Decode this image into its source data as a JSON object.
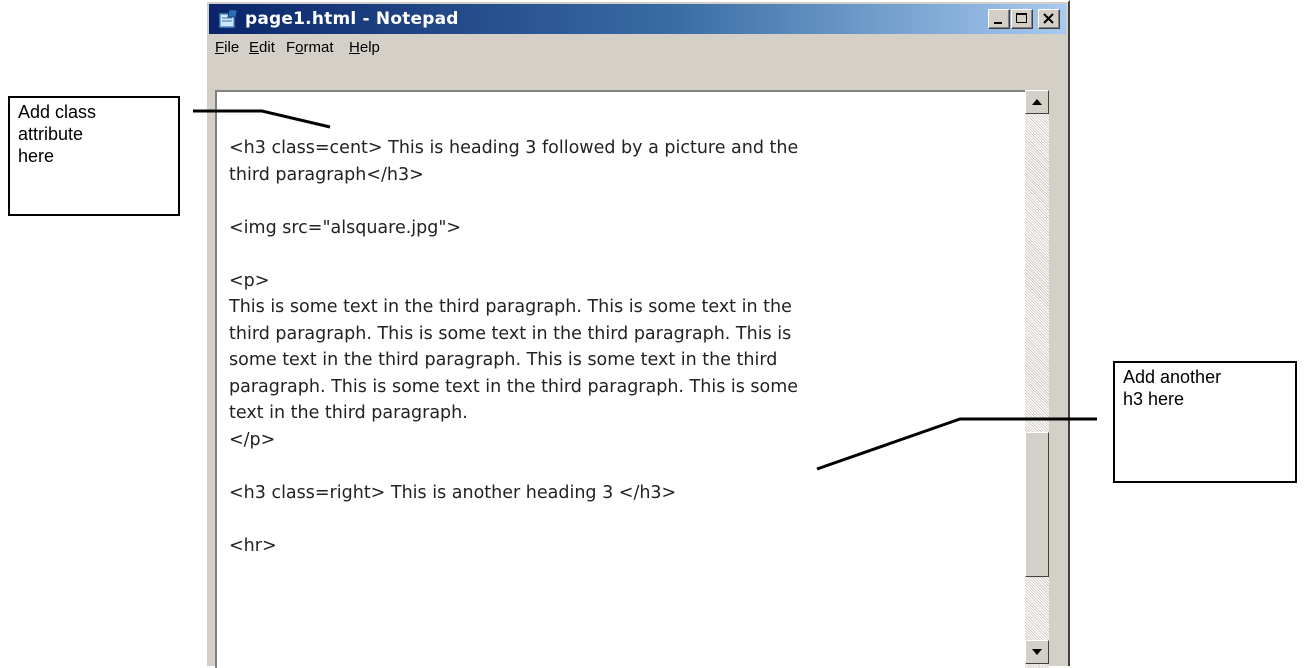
{
  "window": {
    "title": "page1.html - Notepad",
    "icon": "notepad-icon"
  },
  "menu": [
    {
      "label": "File",
      "mnemonic_index": 0
    },
    {
      "label": "Edit",
      "mnemonic_index": 0
    },
    {
      "label": "Format",
      "mnemonic_index": 1
    },
    {
      "label": "Help",
      "mnemonic_index": 0
    }
  ],
  "editor": {
    "text": "<h3 class=cent> This is heading 3 followed by a picture and the\nthird paragraph</h3>\n\n<img src=\"alsquare.jpg\">\n\n<p>\nThis is some text in the third paragraph. This is some text in the\nthird paragraph. This is some text in the third paragraph. This is\nsome text in the third paragraph. This is some text in the third\nparagraph. This is some text in the third paragraph. This is some\ntext in the third paragraph.\n</p>\n\n<h3 class=right> This is another heading 3 </h3>\n\n<hr>"
  },
  "callouts": {
    "left": "Add class\nattribute\nhere",
    "right": "Add another\nh3 here"
  }
}
